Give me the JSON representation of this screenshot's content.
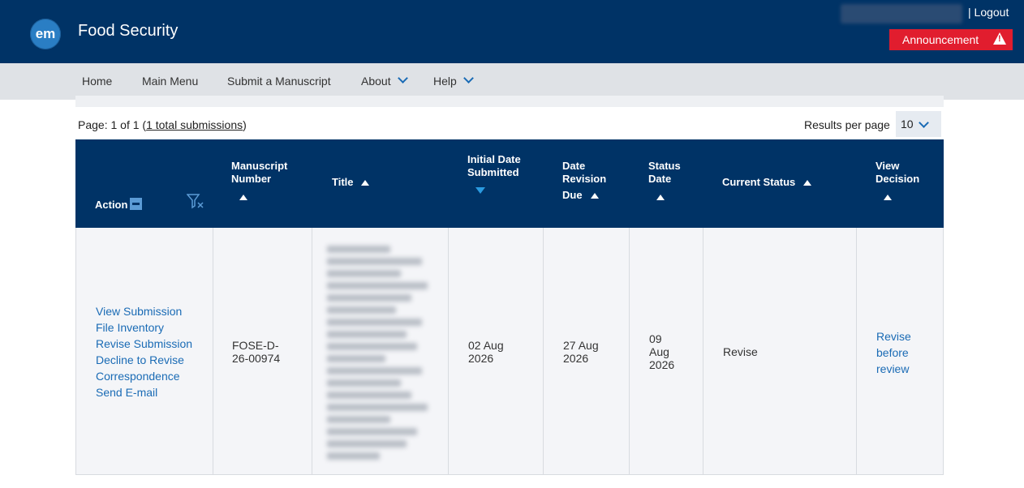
{
  "header": {
    "logo_text": "em",
    "app_title": "Food Security",
    "logout": "| Logout",
    "announcement": "Announcement"
  },
  "nav": {
    "items": [
      "Home",
      "Main Menu",
      "Submit a Manuscript",
      "About",
      "Help"
    ]
  },
  "pager": {
    "page_prefix": "Page: 1 of 1 (",
    "total_link": "1 total submissions",
    "page_suffix": ")",
    "results_per_page_label": "Results per page",
    "results_per_page_value": "10"
  },
  "table": {
    "headers": {
      "action": "Action",
      "manuscript_number": "Manuscript Number",
      "title": "Title",
      "initial_date": "Initial Date Submitted",
      "date_revision_due_1": "Date Revision",
      "date_revision_due_2": "Due",
      "status_date": "Status Date",
      "current_status": "Current Status",
      "view_decision": "View Decision"
    },
    "row": {
      "actions": [
        "View Submission",
        "File Inventory",
        "Revise Submission",
        "Decline to Revise",
        "Correspondence",
        "Send E-mail"
      ],
      "manuscript_number": "FOSE-D-26-00974",
      "initial_date": "02 Aug 2026",
      "revision_due": "27 Aug 2026",
      "status_date": "09 Aug 2026",
      "current_status": "Revise",
      "view_decision": "Revise before review"
    }
  },
  "colors": {
    "header_bg": "#003366",
    "announcement_bg": "#e11d2e",
    "link": "#1a6bb5"
  }
}
